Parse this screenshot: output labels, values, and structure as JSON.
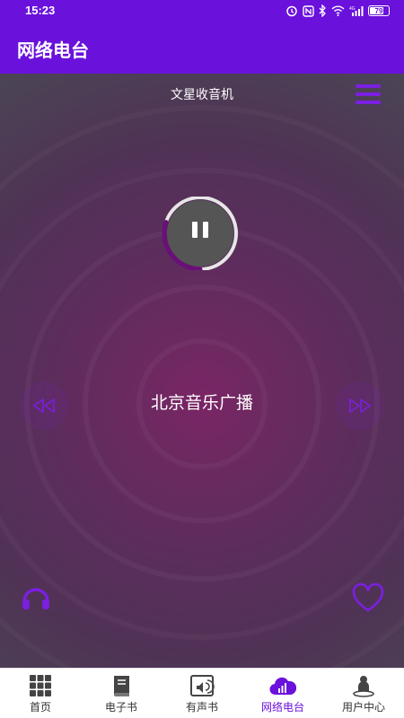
{
  "status_bar": {
    "time": "15:23",
    "battery_level": "79",
    "icons": [
      "alarm-icon",
      "nfc-icon",
      "bluetooth-icon",
      "wifi-icon",
      "signal-4g-icon",
      "battery-icon"
    ]
  },
  "app_bar": {
    "title": "网络电台"
  },
  "player": {
    "provider": "文星收音机",
    "station_name": "北京音乐广播",
    "state": "playing",
    "progress": 0.3,
    "accent_color": "#7b1fe0"
  },
  "bottom_nav": {
    "active_index": 3,
    "items": [
      {
        "label": "首页",
        "icon": "grid-home-icon"
      },
      {
        "label": "电子书",
        "icon": "ebook-icon"
      },
      {
        "label": "有声书",
        "icon": "audiobook-icon"
      },
      {
        "label": "网络电台",
        "icon": "radio-cloud-icon"
      },
      {
        "label": "用户中心",
        "icon": "user-center-icon"
      }
    ]
  },
  "colors": {
    "primary": "#6a11dc",
    "accent": "#7b1fe0"
  }
}
